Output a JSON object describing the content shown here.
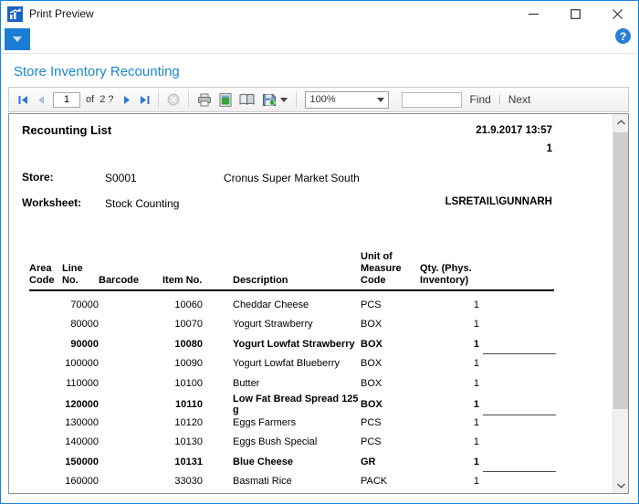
{
  "window": {
    "title": "Print Preview"
  },
  "menubar": {
    "help_glyph": "?"
  },
  "heading": "Store Inventory Recounting",
  "toolbar": {
    "current_page": "1",
    "of_label": "of",
    "total_pages": "2 ?",
    "zoom_value": "100%",
    "search_value": "",
    "find_label": "Find",
    "separator": "|",
    "next_label": "Next"
  },
  "report": {
    "title": "Recounting List",
    "datetime": "21.9.2017 13:57",
    "page_number": "1",
    "store_label": "Store:",
    "store_code": "S0001",
    "store_name": "Cronus Super Market South",
    "worksheet_label": "Worksheet:",
    "worksheet_value": "Stock Counting",
    "user": "LSRETAIL\\GUNNARH",
    "columns": {
      "area": "Area\nCode",
      "line": "Line\nNo.",
      "barcode": "Barcode",
      "item": "Item No.",
      "description": "Description",
      "uom": "Unit of\nMeasure\nCode",
      "qty": "Qty. (Phys.\n Inventory)"
    },
    "rows": [
      {
        "line_no": "70000",
        "item_no": "10060",
        "description": "Cheddar Cheese",
        "uom": "PCS",
        "qty": "1",
        "bold": false
      },
      {
        "line_no": "80000",
        "item_no": "10070",
        "description": "Yogurt Strawberry",
        "uom": "BOX",
        "qty": "1",
        "bold": false
      },
      {
        "line_no": "90000",
        "item_no": "10080",
        "description": "Yogurt Lowfat Strawberry",
        "uom": "BOX",
        "qty": "1",
        "bold": true
      },
      {
        "line_no": "100000",
        "item_no": "10090",
        "description": "Yogurt Lowfat Blueberry",
        "uom": "BOX",
        "qty": "1",
        "bold": false
      },
      {
        "line_no": "110000",
        "item_no": "10100",
        "description": "Butter",
        "uom": "BOX",
        "qty": "1",
        "bold": false
      },
      {
        "line_no": "120000",
        "item_no": "10110",
        "description": "Low Fat Bread Spread 125 g",
        "uom": "BOX",
        "qty": "1",
        "bold": true
      },
      {
        "line_no": "130000",
        "item_no": "10120",
        "description": "Eggs Farmers",
        "uom": "PCS",
        "qty": "1",
        "bold": false
      },
      {
        "line_no": "140000",
        "item_no": "10130",
        "description": "Eggs Bush Special",
        "uom": "PCS",
        "qty": "1",
        "bold": false
      },
      {
        "line_no": "150000",
        "item_no": "10131",
        "description": "Blue Cheese",
        "uom": "GR",
        "qty": "1",
        "bold": true
      },
      {
        "line_no": "160000",
        "item_no": "33030",
        "description": "Basmati Rice",
        "uom": "PACK",
        "qty": "1",
        "bold": false
      }
    ]
  },
  "colors": {
    "accent_blue": "#1d7cd4",
    "heading_blue": "#1a86d0",
    "window_border": "#1883d7"
  }
}
